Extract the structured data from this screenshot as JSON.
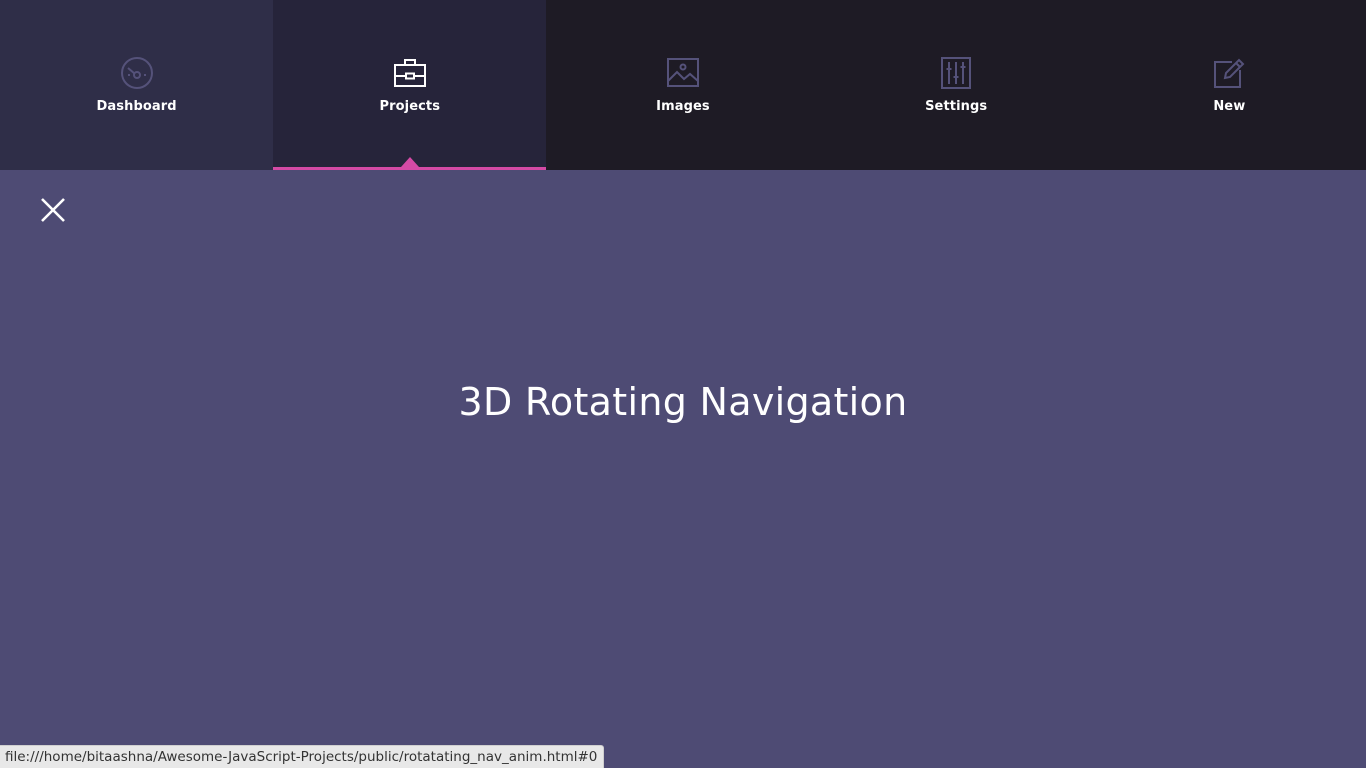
{
  "nav": {
    "items": [
      {
        "label": "Dashboard",
        "icon": "speedometer-icon"
      },
      {
        "label": "Projects",
        "icon": "briefcase-icon",
        "active": true
      },
      {
        "label": "Images",
        "icon": "image-icon"
      },
      {
        "label": "Settings",
        "icon": "sliders-icon"
      },
      {
        "label": "New",
        "icon": "edit-icon"
      }
    ],
    "accent_color": "#d44aa5"
  },
  "main": {
    "title": "3D Rotating Navigation",
    "close_icon": "close-icon"
  },
  "status_bar": {
    "url": "file:///home/bitaashna/Awesome-JavaScript-Projects/public/rotatating_nav_anim.html#0"
  }
}
